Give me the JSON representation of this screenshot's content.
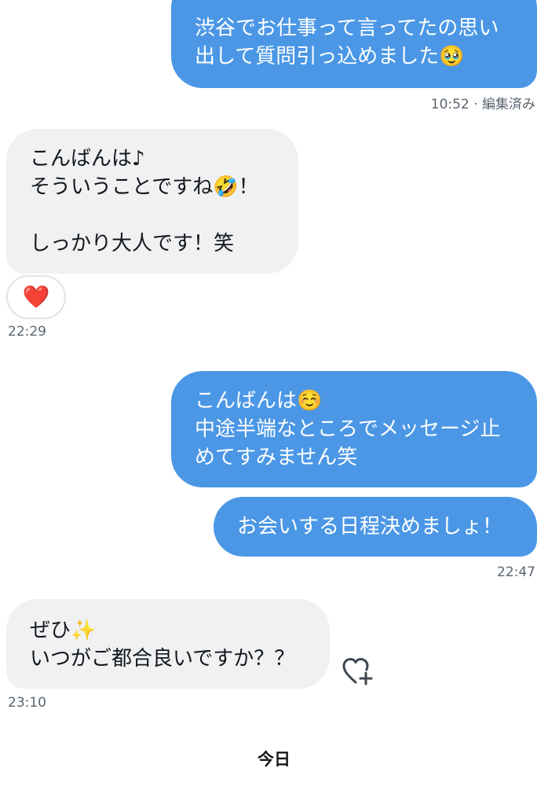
{
  "messages": {
    "m1": {
      "text": "渋谷でお仕事って言ってたの思い\n出して質問引っ込めました🥹",
      "time": "10:52 · 編集済み"
    },
    "m2": {
      "text": "こんばんは♪\nそういうことですね🤣！\n\nしっかり大人です！笑",
      "reaction": "❤️",
      "time": "22:29"
    },
    "m3": {
      "text": "こんばんは☺️\n中途半端なところでメッセージ止\nめてすみません笑"
    },
    "m4": {
      "text": "お会いする日程決めましょ！",
      "time": "22:47"
    },
    "m5": {
      "text": "ぜひ✨\nいつがご都合良いですか？？",
      "time": "23:10"
    }
  },
  "divider": {
    "label": "今日"
  },
  "icons": {
    "add_reaction": "heart-plus-icon"
  },
  "colors": {
    "outgoing": "#4b97e6",
    "incoming": "#eff1f3",
    "meta": "#5b6570"
  }
}
